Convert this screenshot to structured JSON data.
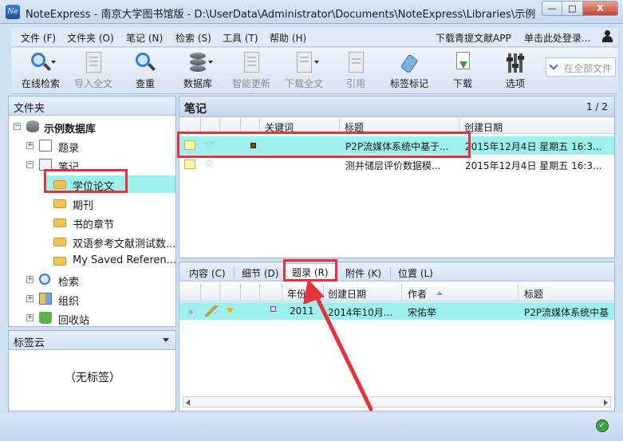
{
  "window": {
    "title": "NoteExpress - 南京大学图书馆版 - D:\\UserData\\Administrator\\Documents\\NoteExpress\\Libraries\\示例数据库.nel",
    "app_icon_text": "Ne",
    "minimize": "—",
    "maximize": "□",
    "close": "X"
  },
  "menu": {
    "items": [
      "文件 (F)",
      "文件夹 (O)",
      "笔记 (N)",
      "检索 (S)",
      "工具 (T)",
      "帮助 (H)"
    ],
    "right": [
      "下载青提文献APP",
      "单击此处登录..."
    ]
  },
  "toolbar": {
    "buttons": [
      {
        "label": "在线检索",
        "icon": "search-globe-icon",
        "enabled": true
      },
      {
        "label": "导入全文",
        "icon": "import-document-icon",
        "enabled": false
      },
      {
        "label": "查重",
        "icon": "magnifier-icon",
        "enabled": true
      },
      {
        "label": "数据库",
        "icon": "database-icon",
        "enabled": true
      },
      {
        "label": "智能更新",
        "icon": "smart-update-icon",
        "enabled": false
      },
      {
        "label": "下载全文",
        "icon": "download-fulltext-icon",
        "enabled": false
      },
      {
        "label": "引用",
        "icon": "cite-icon",
        "enabled": false
      },
      {
        "label": "标签标记",
        "icon": "tag-icon",
        "enabled": true
      },
      {
        "label": "下载",
        "icon": "download-icon",
        "enabled": true
      },
      {
        "label": "选项",
        "icon": "options-icon",
        "enabled": true
      }
    ],
    "search_placeholder": "在全部文件"
  },
  "left": {
    "header": "文件夹",
    "tree": [
      {
        "label": "示例数据库",
        "toggle": "−",
        "bold": true
      },
      {
        "label": "题录",
        "toggle": "+"
      },
      {
        "label": "笔记",
        "toggle": "−"
      },
      {
        "label": "学位论文",
        "selected": true
      },
      {
        "label": "期刊"
      },
      {
        "label": "书的章节"
      },
      {
        "label": "双语参考文献测试数..."
      },
      {
        "label": "My Saved Referen..."
      },
      {
        "label": "检索",
        "toggle": "+"
      },
      {
        "label": "组织",
        "toggle": "+"
      },
      {
        "label": "回收站",
        "toggle": "+"
      }
    ]
  },
  "tagcloud": {
    "header": "标签云",
    "empty_text": "（无标签）"
  },
  "notes": {
    "title": "笔记",
    "page": "1 / 2",
    "columns": [
      "关键词",
      "标题",
      "创建日期"
    ],
    "rows": [
      {
        "keyword": "",
        "title": "P2P流媒体系统中基于...",
        "date": "2015年12月4日 星期五 16:3..."
      },
      {
        "keyword": "",
        "title": "测井储层评价数据模...",
        "date": "2015年12月4日 星期五 16:3..."
      }
    ]
  },
  "detail": {
    "tabs": [
      "内容 (C)",
      "细节 (D)",
      "题录 (R)",
      "附件 (K)",
      "位置 (L)"
    ],
    "active_tab": 2,
    "columns": [
      "年份",
      "创建日期",
      "作者",
      "标题"
    ],
    "rows": [
      {
        "year": "2011",
        "created": "2014年10月...",
        "author": "宋佑举",
        "title": "P2P流媒体系统中基"
      }
    ]
  },
  "colors": {
    "highlight": "#9cf1ef",
    "annotation_red": "#e8313a"
  }
}
